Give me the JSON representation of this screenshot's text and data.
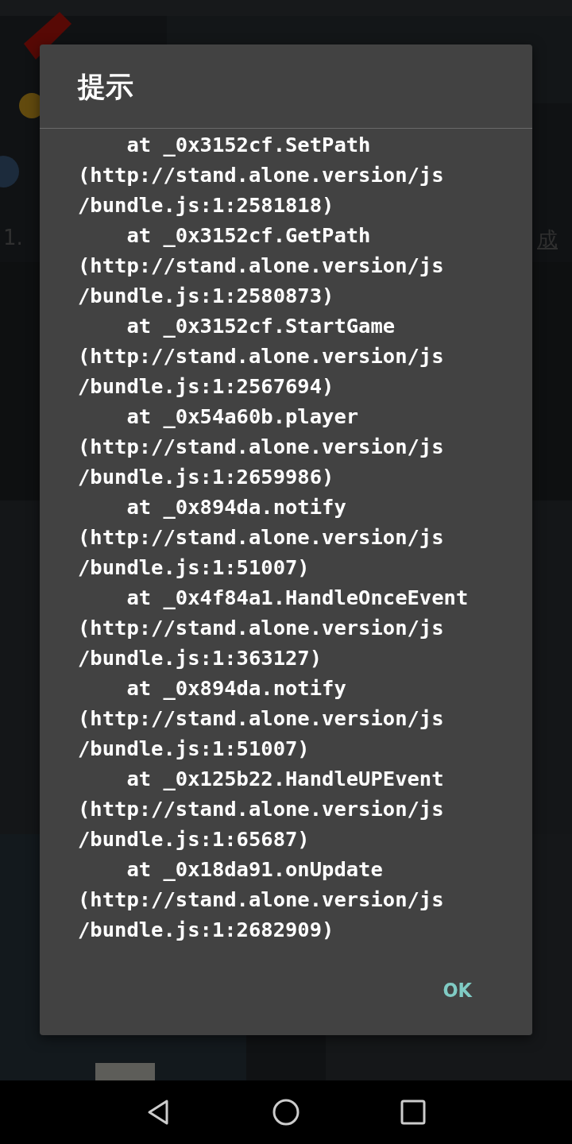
{
  "background": {
    "texts": [
      {
        "kind": "left",
        "text": "1."
      },
      {
        "kind": "right",
        "text": "成"
      }
    ]
  },
  "dialog": {
    "title": "提示",
    "message_lines": [
      "    at _0x3152cf.SetPath",
      "(http://stand.alone.version/js",
      "/bundle.js:1:2581818)",
      "    at _0x3152cf.GetPath",
      "(http://stand.alone.version/js",
      "/bundle.js:1:2580873)",
      "    at _0x3152cf.StartGame",
      "(http://stand.alone.version/js",
      "/bundle.js:1:2567694)",
      "    at _0x54a60b.player",
      "(http://stand.alone.version/js",
      "/bundle.js:1:2659986)",
      "    at _0x894da.notify",
      "(http://stand.alone.version/js",
      "/bundle.js:1:51007)",
      "    at _0x4f84a1.HandleOnceEvent",
      "(http://stand.alone.version/js",
      "/bundle.js:1:363127)",
      "    at _0x894da.notify",
      "(http://stand.alone.version/js",
      "/bundle.js:1:51007)",
      "    at _0x125b22.HandleUPEvent",
      "(http://stand.alone.version/js",
      "/bundle.js:1:65687)",
      "    at _0x18da91.onUpdate",
      "(http://stand.alone.version/js",
      "/bundle.js:1:2682909)"
    ],
    "buttons": [
      "OK"
    ]
  },
  "nav_bar": {
    "buttons": [
      {
        "kind": "back"
      },
      {
        "kind": "home"
      },
      {
        "kind": "recents"
      }
    ]
  }
}
